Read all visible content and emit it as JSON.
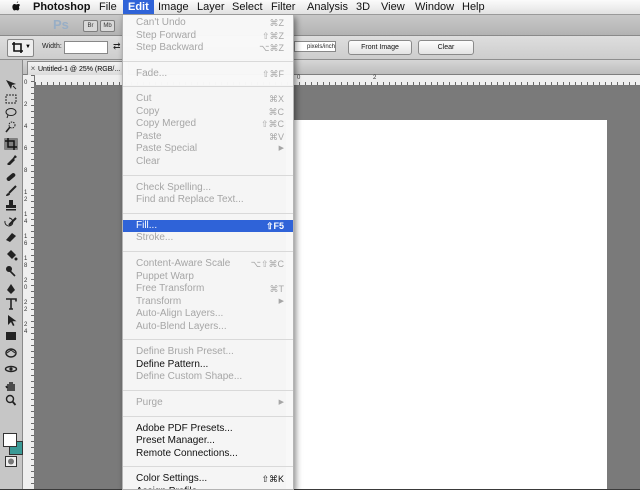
{
  "menubar": {
    "app_name": "Photoshop",
    "items": [
      "File",
      "Edit",
      "Image",
      "Layer",
      "Select",
      "Filter",
      "Analysis",
      "3D",
      "View",
      "Window",
      "Help"
    ],
    "active_item": "Edit"
  },
  "appbar": {
    "logo": "Ps",
    "mini_buttons": [
      "Br",
      "Mb"
    ]
  },
  "options_bar": {
    "width_label": "Width:",
    "width_value": "",
    "units_value": "pixels/inch",
    "front_image_label": "Front Image",
    "clear_label": "Clear"
  },
  "document": {
    "tab_title": "Untitled-1 @ 25% (RGB/...",
    "tab_close": "×",
    "ruler_top_numbers": [
      "0",
      "2"
    ],
    "ruler_left_numbers": [
      "0",
      "2",
      "4",
      "6",
      "8",
      "1",
      "2",
      "1",
      "4",
      "1",
      "6",
      "1",
      "8",
      "2",
      "0",
      "2",
      "2",
      "2",
      "4"
    ]
  },
  "tools": [
    "move",
    "marquee",
    "lasso",
    "quick-select",
    "crop",
    "eyedropper",
    "spot-heal",
    "brush",
    "clone-stamp",
    "history-brush",
    "eraser",
    "gradient",
    "dodge",
    "pen",
    "type",
    "path-select",
    "shape",
    "3d-rotate",
    "3d-orbit",
    "hand",
    "zoom"
  ],
  "selected_tool": "crop",
  "colors": {
    "menu_highlight": "#2f63d8",
    "foreground": "#ffffff",
    "background": "#3a9a96",
    "canvas": "#ffffff",
    "pasteboard": "#7a7a7a"
  },
  "edit_menu": {
    "items": [
      {
        "label": "Can't Undo",
        "shortcut": "⌘Z",
        "enabled": false
      },
      {
        "label": "Step Forward",
        "shortcut": "⇧⌘Z",
        "enabled": false
      },
      {
        "label": "Step Backward",
        "shortcut": "⌥⌘Z",
        "enabled": false
      },
      {
        "separator": true
      },
      {
        "label": "Fade...",
        "shortcut": "⇧⌘F",
        "enabled": false
      },
      {
        "separator": true
      },
      {
        "label": "Cut",
        "shortcut": "⌘X",
        "enabled": false
      },
      {
        "label": "Copy",
        "shortcut": "⌘C",
        "enabled": false
      },
      {
        "label": "Copy Merged",
        "shortcut": "⇧⌘C",
        "enabled": false
      },
      {
        "label": "Paste",
        "shortcut": "⌘V",
        "enabled": false
      },
      {
        "label": "Paste Special",
        "submenu": true,
        "enabled": false
      },
      {
        "label": "Clear",
        "enabled": false
      },
      {
        "separator": true
      },
      {
        "label": "Check Spelling...",
        "enabled": false
      },
      {
        "label": "Find and Replace Text...",
        "enabled": false
      },
      {
        "separator": true
      },
      {
        "label": "Fill...",
        "shortcut": "⇧F5",
        "enabled": true,
        "highlighted": true
      },
      {
        "label": "Stroke...",
        "enabled": false
      },
      {
        "separator": true
      },
      {
        "label": "Content-Aware Scale",
        "shortcut": "⌥⇧⌘C",
        "enabled": false
      },
      {
        "label": "Puppet Warp",
        "enabled": false
      },
      {
        "label": "Free Transform",
        "shortcut": "⌘T",
        "enabled": false
      },
      {
        "label": "Transform",
        "submenu": true,
        "enabled": false
      },
      {
        "label": "Auto-Align Layers...",
        "enabled": false
      },
      {
        "label": "Auto-Blend Layers...",
        "enabled": false
      },
      {
        "separator": true
      },
      {
        "label": "Define Brush Preset...",
        "enabled": false
      },
      {
        "label": "Define Pattern...",
        "enabled": true
      },
      {
        "label": "Define Custom Shape...",
        "enabled": false
      },
      {
        "separator": true
      },
      {
        "label": "Purge",
        "submenu": true,
        "enabled": false
      },
      {
        "separator": true
      },
      {
        "label": "Adobe PDF Presets...",
        "enabled": true
      },
      {
        "label": "Preset Manager...",
        "enabled": true
      },
      {
        "label": "Remote Connections...",
        "enabled": true
      },
      {
        "separator": true
      },
      {
        "label": "Color Settings...",
        "shortcut": "⇧⌘K",
        "enabled": true
      },
      {
        "label": "Assign Profile...",
        "enabled": true
      }
    ]
  }
}
